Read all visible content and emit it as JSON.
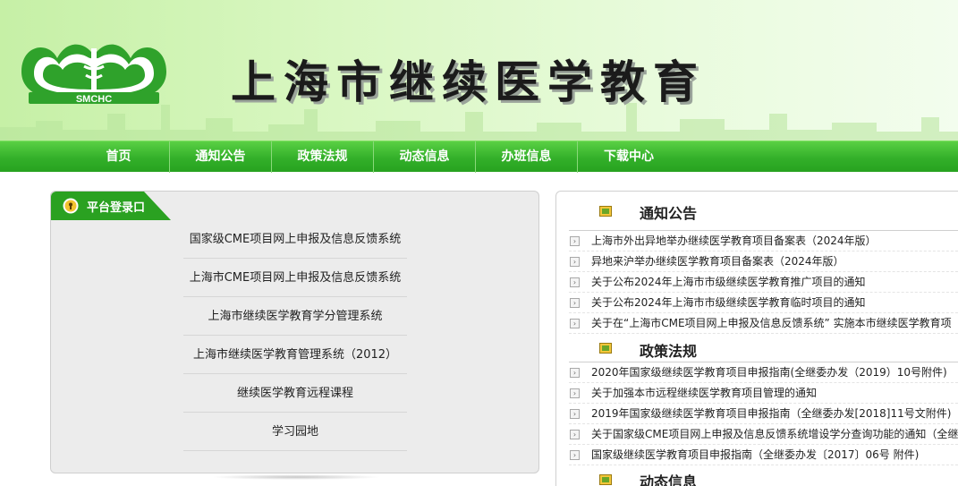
{
  "header": {
    "site_title": "上海市继续医学教育",
    "logo_text": "SMCHC"
  },
  "nav": {
    "items": [
      {
        "label": "首页"
      },
      {
        "label": "通知公告"
      },
      {
        "label": "政策法规"
      },
      {
        "label": "动态信息"
      },
      {
        "label": "办班信息"
      },
      {
        "label": "下载中心"
      }
    ]
  },
  "login": {
    "tab_label": "平台登录口",
    "systems": [
      {
        "label": "国家级CME项目网上申报及信息反馈系统"
      },
      {
        "label": "上海市CME项目网上申报及信息反馈系统"
      },
      {
        "label": "上海市继续医学教育学分管理系统"
      },
      {
        "label": "上海市继续医学教育管理系统（2012）"
      },
      {
        "label": "继续医学教育远程课程"
      },
      {
        "label": "学习园地"
      }
    ]
  },
  "news": {
    "notices": {
      "title": "通知公告",
      "items": [
        {
          "label": "上海市外出异地举办继续医学教育项目备案表（2024年版）"
        },
        {
          "label": "异地来沪举办继续医学教育项目备案表（2024年版）"
        },
        {
          "label": "关于公布2024年上海市市级继续医学教育推广项目的通知"
        },
        {
          "label": "关于公布2024年上海市市级继续医学教育临时项目的通知"
        },
        {
          "label": "关于在“上海市CME项目网上申报及信息反馈系统” 实施本市继续医学教育项"
        }
      ]
    },
    "policies": {
      "title": "政策法规",
      "items": [
        {
          "label": "2020年国家级继续医学教育项目申报指南(全继委办发（2019）10号附件)"
        },
        {
          "label": "关于加强本市远程继续医学教育项目管理的通知"
        },
        {
          "label": "2019年国家级继续医学教育项目申报指南（全继委办发[2018]11号文附件)"
        },
        {
          "label": "关于国家级CME项目网上申报及信息反馈系统增设学分查询功能的通知（全继"
        },
        {
          "label": "国家级继续医学教育项目申报指南（全继委办发〔2017〕06号 附件)"
        }
      ]
    },
    "dynamics": {
      "title": "动态信息"
    }
  },
  "colors": {
    "nav_green": "#33b02a",
    "tab_green": "#2aa121",
    "banner_light": "#d9f7c2"
  }
}
